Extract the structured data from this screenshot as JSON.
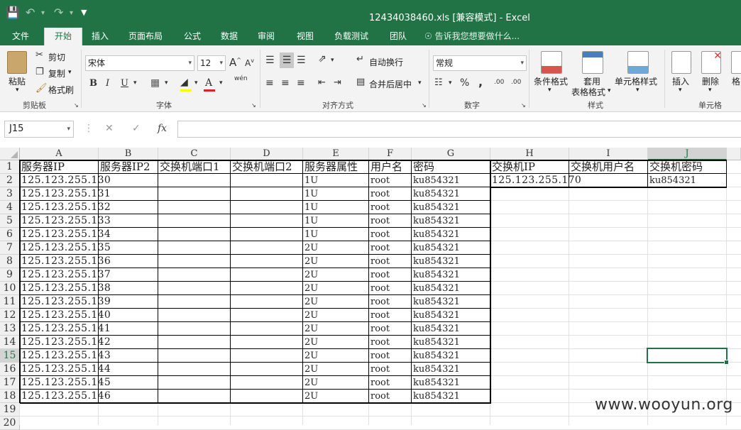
{
  "window": {
    "title": "12434038460.xls  [兼容模式] - Excel"
  },
  "tabs": [
    "文件",
    "开始",
    "插入",
    "页面布局",
    "公式",
    "数据",
    "审阅",
    "视图",
    "负载测试",
    "团队"
  ],
  "active_tab": "开始",
  "tell_me": "告诉我您想要做什么...",
  "ribbon": {
    "clipboard": {
      "label": "剪贴板",
      "paste": "粘贴",
      "cut": "剪切",
      "copy": "复制",
      "format_painter": "格式刷"
    },
    "font": {
      "label": "字体",
      "name": "宋体",
      "size": "12",
      "bold": "B",
      "italic": "I",
      "underline": "U",
      "phonetic": "wén",
      "grow": "A",
      "shrink": "A"
    },
    "alignment": {
      "label": "对齐方式",
      "wrap": "自动换行",
      "merge": "合并后居中"
    },
    "number": {
      "label": "数字",
      "format": "常规",
      "percent": "%",
      "comma": ",",
      "dec_inc": ".00",
      "dec_dec": ".00"
    },
    "styles": {
      "label": "样式",
      "conditional": "条件格式",
      "table": "套用",
      "table2": "表格格式",
      "cell_styles": "单元格样式"
    },
    "cells": {
      "label": "单元格",
      "insert": "插入",
      "delete": "删除",
      "format": "格"
    }
  },
  "formula_bar": {
    "name_box": "J15",
    "cancel": "✕",
    "enter": "✓",
    "fx": "fx",
    "value": ""
  },
  "columns": [
    "A",
    "B",
    "C",
    "D",
    "E",
    "F",
    "G",
    "H",
    "I",
    "J"
  ],
  "rows": [
    "1",
    "2",
    "3",
    "4",
    "5",
    "6",
    "7",
    "8",
    "9",
    "10",
    "11",
    "12",
    "13",
    "14",
    "15",
    "16",
    "17",
    "18",
    "19",
    "20"
  ],
  "header_row": [
    "服务器IP",
    "服务器IP2",
    "交换机端口1",
    "交换机端口2",
    "服务器属性",
    "用户名",
    "密码",
    "交换机IP",
    "交换机用户名",
    "交换机密码"
  ],
  "servers": [
    {
      "ip": "125.123.255.130",
      "attr": "1U",
      "user": "root",
      "pass": "ku854321"
    },
    {
      "ip": "125.123.255.131",
      "attr": "1U",
      "user": "root",
      "pass": "ku854321"
    },
    {
      "ip": "125.123.255.132",
      "attr": "1U",
      "user": "root",
      "pass": "ku854321"
    },
    {
      "ip": "125.123.255.133",
      "attr": "1U",
      "user": "root",
      "pass": "ku854321"
    },
    {
      "ip": "125.123.255.134",
      "attr": "1U",
      "user": "root",
      "pass": "ku854321"
    },
    {
      "ip": "125.123.255.135",
      "attr": "2U",
      "user": "root",
      "pass": "ku854321"
    },
    {
      "ip": "125.123.255.136",
      "attr": "2U",
      "user": "root",
      "pass": "ku854321"
    },
    {
      "ip": "125.123.255.137",
      "attr": "2U",
      "user": "root",
      "pass": "ku854321"
    },
    {
      "ip": "125.123.255.138",
      "attr": "2U",
      "user": "root",
      "pass": "ku854321"
    },
    {
      "ip": "125.123.255.139",
      "attr": "2U",
      "user": "root",
      "pass": "ku854321"
    },
    {
      "ip": "125.123.255.140",
      "attr": "2U",
      "user": "root",
      "pass": "ku854321"
    },
    {
      "ip": "125.123.255.141",
      "attr": "2U",
      "user": "root",
      "pass": "ku854321"
    },
    {
      "ip": "125.123.255.142",
      "attr": "2U",
      "user": "root",
      "pass": "ku854321"
    },
    {
      "ip": "125.123.255.143",
      "attr": "2U",
      "user": "root",
      "pass": "ku854321"
    },
    {
      "ip": "125.123.255.144",
      "attr": "2U",
      "user": "root",
      "pass": "ku854321"
    },
    {
      "ip": "125.123.255.145",
      "attr": "2U",
      "user": "root",
      "pass": "ku854321"
    },
    {
      "ip": "125.123.255.146",
      "attr": "2U",
      "user": "root",
      "pass": "ku854321"
    }
  ],
  "switch": {
    "ip": "125.123.255.170",
    "pass": "ku854321"
  },
  "selected_cell": "J15",
  "watermark": "www.wooyun.org",
  "colors": {
    "accent": "#217346",
    "ribbon_bg": "#f3f3f3"
  }
}
